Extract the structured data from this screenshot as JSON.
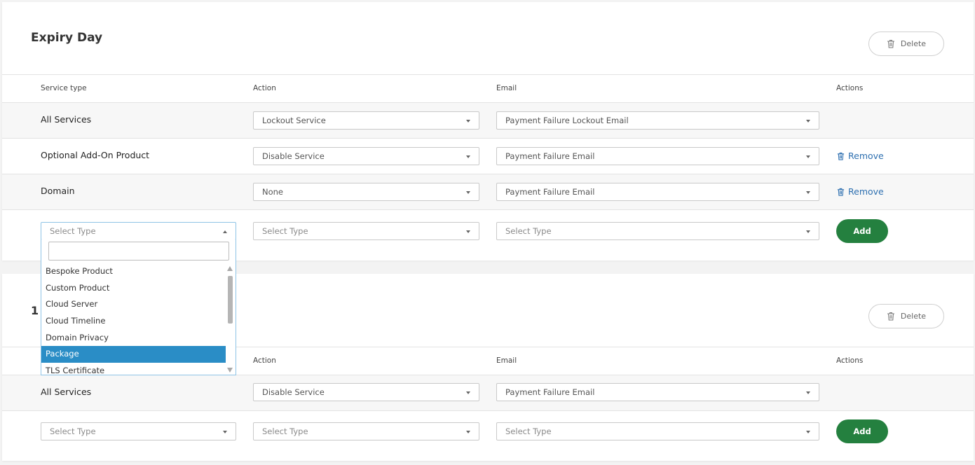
{
  "section1": {
    "title": "Expiry Day",
    "delete_label": "Delete",
    "headers": {
      "service_type": "Service type",
      "action": "Action",
      "email": "Email",
      "actions": "Actions"
    },
    "rows": [
      {
        "service": "All Services",
        "action": "Lockout Service",
        "email": "Payment Failure Lockout Email",
        "remove": ""
      },
      {
        "service": "Optional Add-On Product",
        "action": "Disable Service",
        "email": "Payment Failure Email",
        "remove": "Remove"
      },
      {
        "service": "Domain",
        "action": "None",
        "email": "Payment Failure Email",
        "remove": "Remove"
      }
    ],
    "new_row": {
      "type_placeholder": "Select Type",
      "action_placeholder": "Select Type",
      "email_placeholder": "Select Type",
      "add_label": "Add"
    }
  },
  "dropdown": {
    "search_value": "",
    "options": [
      "Bespoke Product",
      "Custom Product",
      "Cloud Server",
      "Cloud Timeline",
      "Domain Privacy",
      "Package",
      "TLS Certificate"
    ],
    "highlighted": "Package"
  },
  "section2": {
    "title": "1",
    "delete_label": "Delete",
    "headers": {
      "action": "Action",
      "email": "Email",
      "actions": "Actions"
    },
    "rows": [
      {
        "service": "All Services",
        "action": "Disable Service",
        "email": "Payment Failure Email"
      }
    ],
    "new_row": {
      "type_placeholder": "Select Type",
      "action_placeholder": "Select Type",
      "email_placeholder": "Select Type",
      "add_label": "Add"
    }
  },
  "colors": {
    "accent_green": "#24803f",
    "link_blue": "#2d6fb0",
    "highlight_blue": "#2a8dc6"
  },
  "icons": {
    "delete": "trash-icon",
    "remove": "trash-icon",
    "select": "caret-down-icon"
  }
}
